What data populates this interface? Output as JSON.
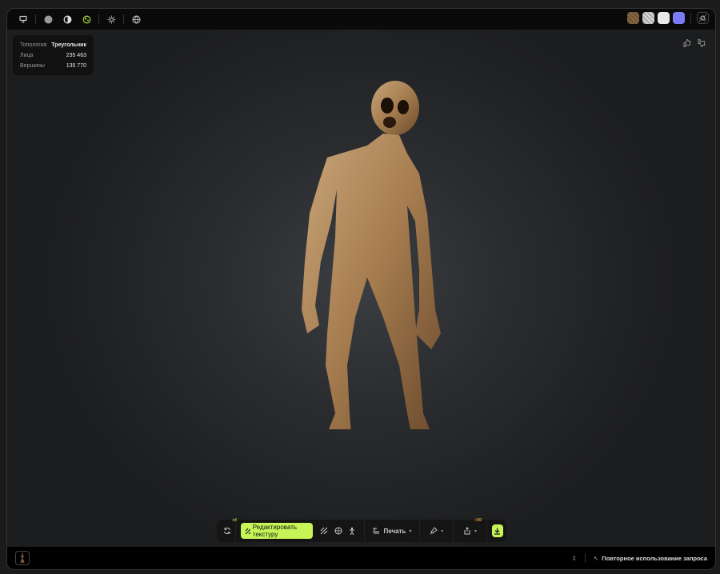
{
  "stats": {
    "rows": [
      {
        "label": "Топология",
        "value": "Треугольник"
      },
      {
        "label": "Лица",
        "value": "235 463"
      },
      {
        "label": "Вершины",
        "value": "135 770"
      }
    ]
  },
  "swatches": {
    "colors": [
      "#8a6a44",
      "#cfcfcf",
      "#e9e9e9",
      "#7a7cf5"
    ]
  },
  "toolbar": {
    "regenerate_badge": "x4",
    "edit_texture_label": "Редактировать текстуру",
    "print_label": "Печать",
    "share_badge": "+50"
  },
  "bottom": {
    "reuse_prompt_label": "Повторное использование запроса"
  },
  "colors": {
    "accent": "#c7f558",
    "badge_green": "#9acd32",
    "badge_orange": "#e0a030"
  }
}
